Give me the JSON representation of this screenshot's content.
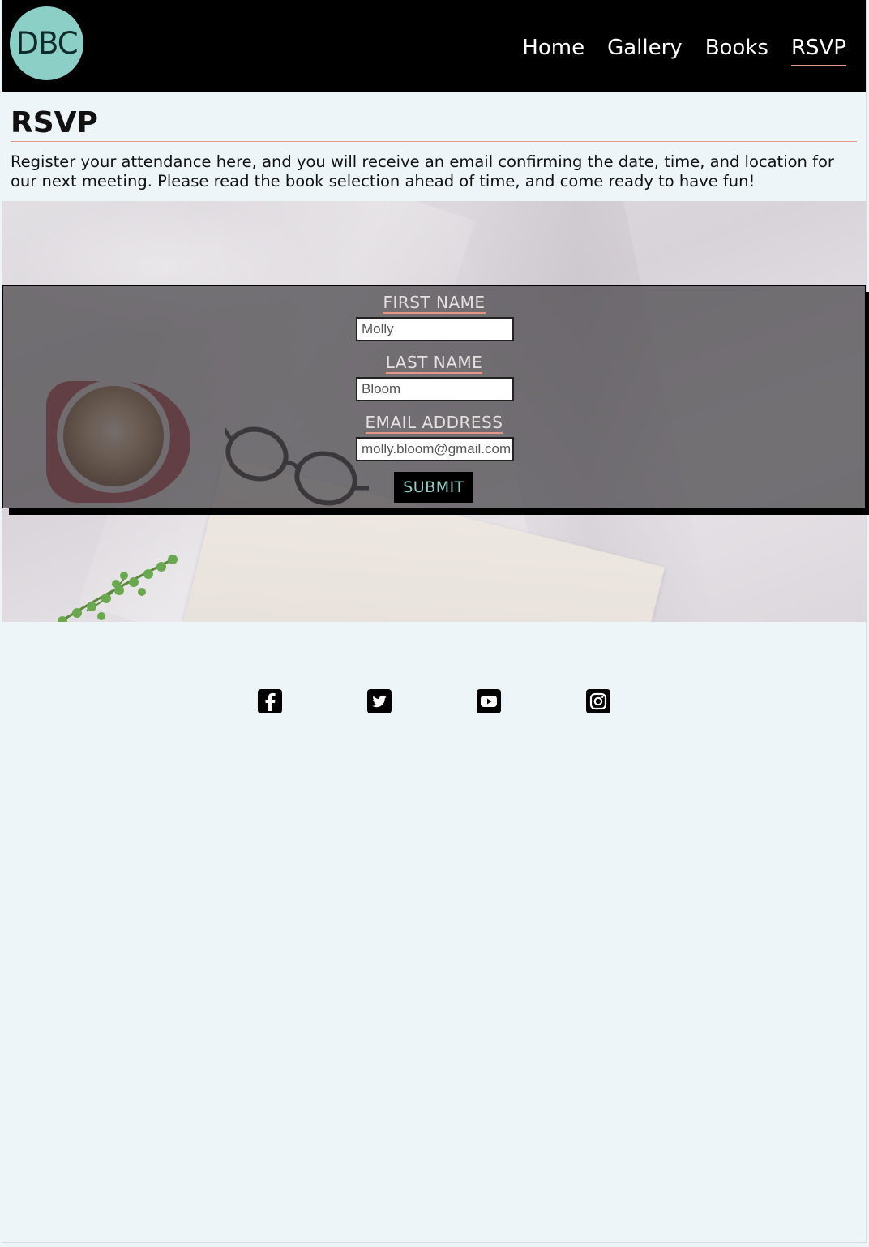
{
  "header": {
    "logo_text": "DBC",
    "nav": [
      {
        "label": "Home"
      },
      {
        "label": "Gallery"
      },
      {
        "label": "Books"
      },
      {
        "label": "RSVP",
        "active": true
      }
    ]
  },
  "page": {
    "title": "RSVP",
    "intro": "Register your attendance here, and you will receive an email confirming the date, time, and location for our next meeting. Please read the book selection ahead of time, and come ready to have fun!"
  },
  "form": {
    "first_name": {
      "label": "FIRST NAME",
      "value": "Molly"
    },
    "last_name": {
      "label": "LAST NAME",
      "value": "Bloom"
    },
    "email": {
      "label": "EMAIL ADDRESS",
      "value": "molly.bloom@gmail.com"
    },
    "submit_label": "SUBMIT"
  },
  "footer": {
    "social_icons": [
      "facebook-icon",
      "twitter-icon",
      "youtube-icon",
      "instagram-icon"
    ]
  },
  "colors": {
    "header_bg": "#000000",
    "page_bg": "#eef5f8",
    "accent_teal": "#8ccfc7",
    "accent_salmon": "#e59686"
  }
}
